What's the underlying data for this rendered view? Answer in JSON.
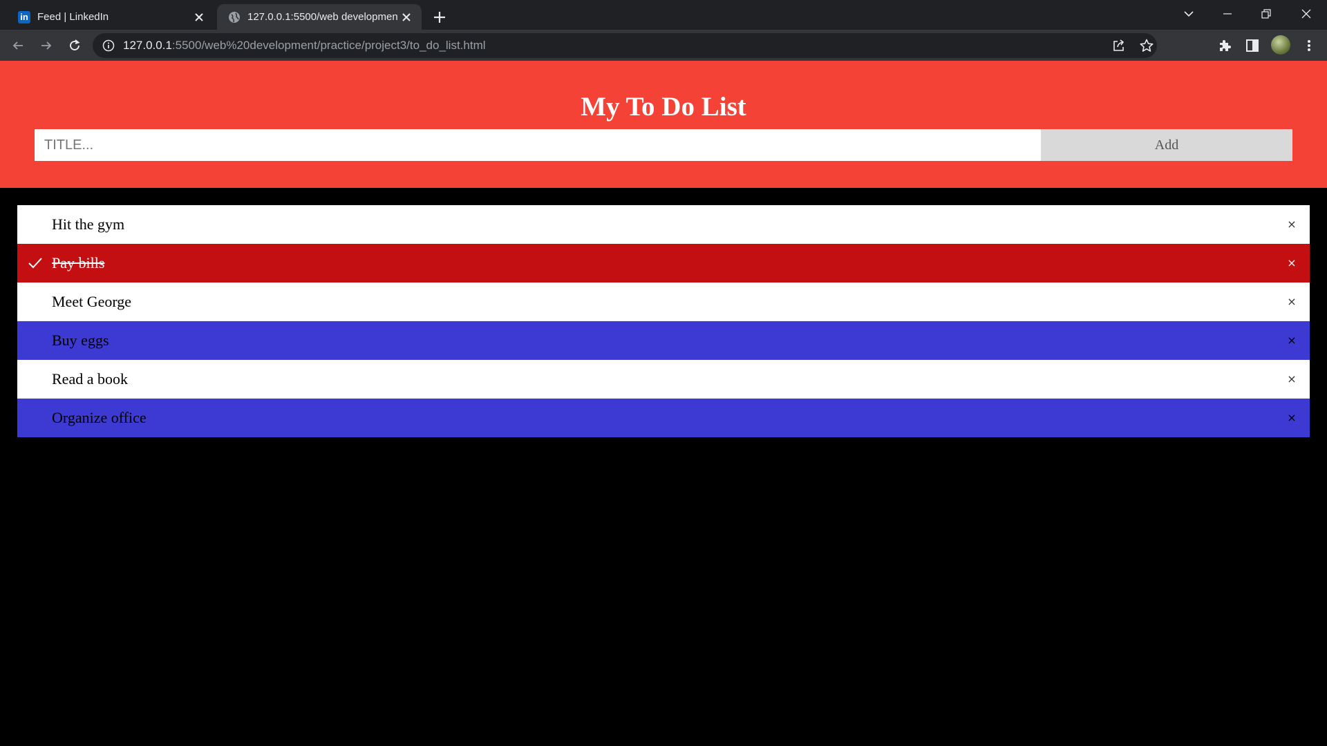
{
  "browser": {
    "tabs": [
      {
        "title": "Feed | LinkedIn",
        "favicon": "linkedin-icon",
        "active": false
      },
      {
        "title": "127.0.0.1:5500/web development",
        "favicon": "globe-icon",
        "active": true
      }
    ],
    "url_host": "127.0.0.1",
    "url_rest": ":5500/web%20development/practice/project3/to_do_list.html"
  },
  "header": {
    "title": "My To Do List",
    "input_placeholder": "TITLE...",
    "add_label": "Add",
    "background": "#f44336"
  },
  "todos": [
    {
      "text": "Hit the gym",
      "checked": false,
      "style": "white"
    },
    {
      "text": "Pay bills",
      "checked": true,
      "style": "checked"
    },
    {
      "text": "Meet George",
      "checked": false,
      "style": "white"
    },
    {
      "text": "Buy eggs",
      "checked": false,
      "style": "blue"
    },
    {
      "text": "Read a book",
      "checked": false,
      "style": "white"
    },
    {
      "text": "Organize office",
      "checked": false,
      "style": "blue"
    }
  ],
  "close_symbol": "×",
  "colors": {
    "checked_row": "#c30e12",
    "alt_row": "#3d39d3",
    "page_bg": "#000000"
  }
}
